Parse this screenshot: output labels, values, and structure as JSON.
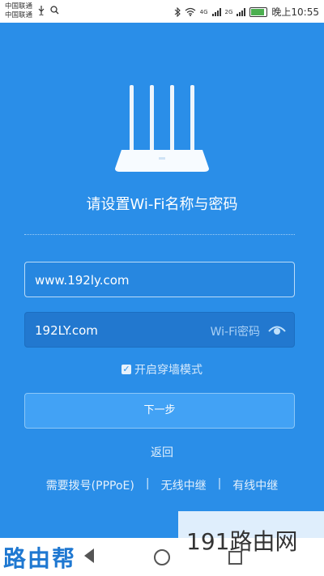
{
  "status_bar": {
    "carrier1": "中国联通",
    "carrier2": "中国联通",
    "network_badge1": "4G",
    "network_badge2": "2G",
    "time": "晚上10:55",
    "battery_level": 0.85
  },
  "title": "请设置Wi-Fi名称与密码",
  "ssid_value": "www.192ly.com",
  "password_value": "192LY.com",
  "password_placeholder": "Wi-Fi密码",
  "wall_mode_label": "开启穿墙模式",
  "next_button_label": "下一步",
  "back_label": "返回",
  "links": {
    "pppoe": "需要拨号(PPPoE)",
    "separator": "|",
    "wireless_relay": "无线中继",
    "wired_relay": "有线中继"
  },
  "watermarks": {
    "left": "路由帮",
    "right": "191路由网"
  },
  "colors": {
    "background": "#2a8ee8",
    "button": "#42a2f5"
  }
}
